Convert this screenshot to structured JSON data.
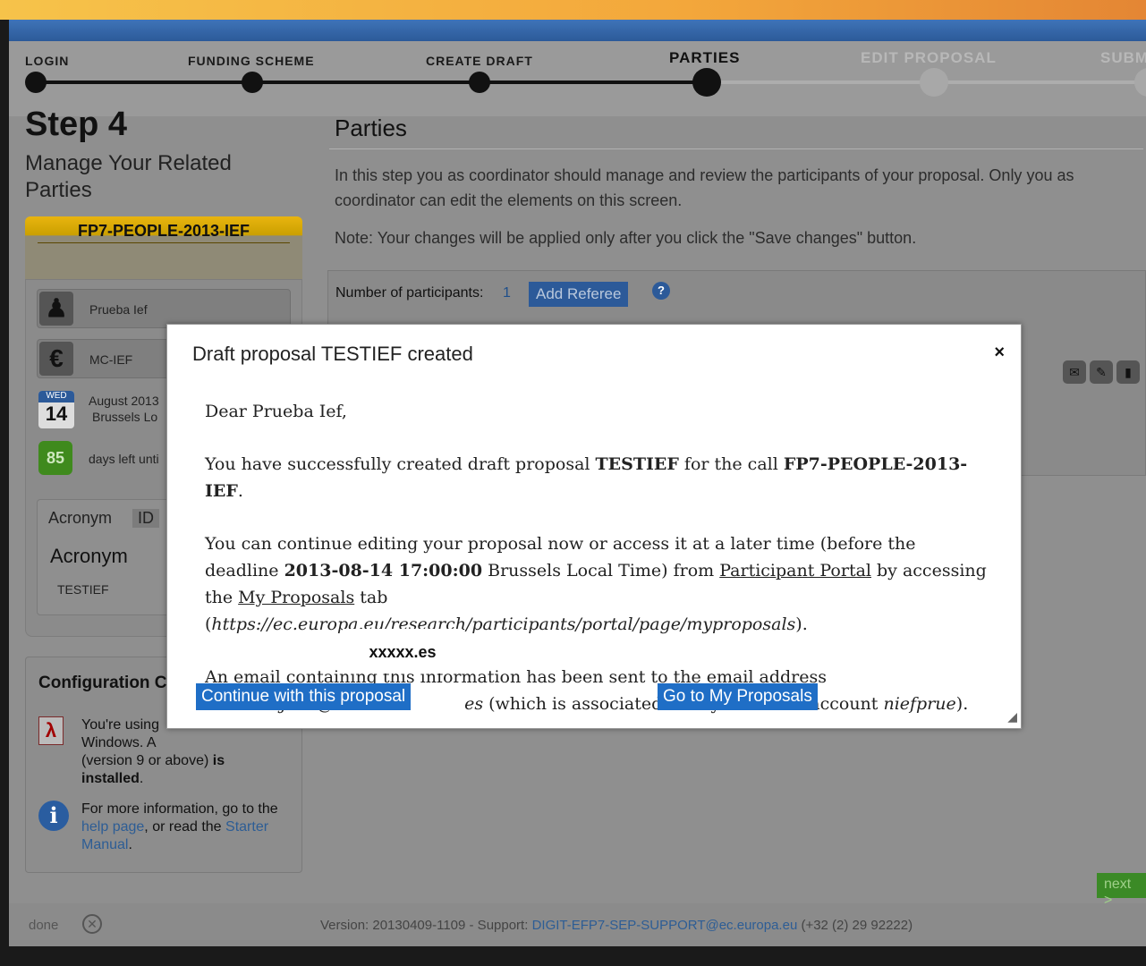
{
  "wizard": {
    "steps": [
      {
        "label": "LOGIN"
      },
      {
        "label": "FUNDING SCHEME"
      },
      {
        "label": "CREATE DRAFT"
      },
      {
        "label": "PARTIES"
      },
      {
        "label": "EDIT PROPOSAL"
      },
      {
        "label": "SUBMI"
      }
    ],
    "current_step": "PARTIES"
  },
  "left": {
    "step_title": "Step 4",
    "step_subtitle": "Manage Your Related Parties",
    "call_id": "FP7-PEOPLE-2013-IEF",
    "user_name": "Prueba Ief",
    "scheme": "MC-IEF",
    "calendar": {
      "weekday": "WED",
      "day": "14",
      "line1": "August 2013",
      "line2": "Brussels Lo"
    },
    "days_left": {
      "count": "85",
      "label": "days left unti"
    },
    "tabs": {
      "acronym_tab": "Acronym",
      "id_tab": "ID",
      "acronym_heading": "Acronym",
      "acronym_value": "TESTIEF"
    },
    "config": {
      "title": "Configuration C",
      "pdf_text_a": "You're using",
      "pdf_text_b": "Windows. A",
      "pdf_text_c": "(version 9 or above)",
      "pdf_text_d": "is",
      "pdf_text_e": "installed",
      "more_info_a": "For more information, go to the",
      "help_link": "help page",
      "more_info_b": ", or read the",
      "manual_link": "Starter Manual",
      "more_info_c": "."
    }
  },
  "right": {
    "title": "Parties",
    "intro": "In this step you as coordinator should manage and review the participants of your proposal. Only you as coordinator can edit the elements on this screen.",
    "note": "Note: Your changes will be applied only after you click the \"Save changes\" button.",
    "num_participants_label": "Number of participants:",
    "num_participants_value": "1",
    "add_referee": "Add Referee",
    "help_icon": "?"
  },
  "modal": {
    "title": "Draft proposal TESTIEF created",
    "close": "×",
    "greeting": "Dear Prueba Ief,",
    "p1_a": "You have successfully created draft proposal ",
    "p1_proposal": "TESTIEF",
    "p1_b": " for the call ",
    "p1_call": "FP7-PEOPLE-2013-IEF",
    "p1_c": ".",
    "p2_a": "You can continue editing your proposal now or access it at a later time (before the deadline ",
    "p2_deadline": "2013-08-14 17:00:00",
    "p2_b": " Brussels Local Time) from ",
    "p2_portal": "Participant Portal",
    "p2_c": " by accessing the ",
    "p2_tab": "My Proposals",
    "p2_d": " tab (",
    "p2_url": "https://ec.europa.eu/research/participants/portal/page/myproposals",
    "p2_e": ").",
    "p3_a": "An email containing this information has been sent to the email address",
    "p3_email": "nicolas.ojeda@o",
    "p3_email_end": "es",
    "p3_b": " (which is associated with your ECAS account ",
    "p3_account": "niefprue",
    "p3_c": ").",
    "mask_text": "xxxxx.es",
    "btn_continue": "Continue with this proposal",
    "btn_go": "Go to My Proposals"
  },
  "footer": {
    "next": "next >",
    "done": "done",
    "version": "Version: 20130409-1109 - Support: ",
    "support_email": "DIGIT-EFP7-SEP-SUPPORT@ec.europa.eu",
    "phone": " (+32 (2) 29 92222)"
  }
}
